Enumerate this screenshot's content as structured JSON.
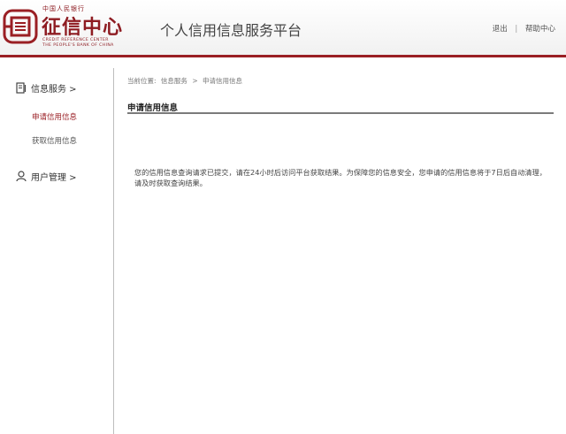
{
  "brand": {
    "top_text": "中国人民银行",
    "name": "征信中心",
    "en_line1": "CREDIT REFERENCE CENTER",
    "en_line2": "THE PEOPLE'S BANK OF CHINA",
    "color": "#9a1f24"
  },
  "header": {
    "title": "个人信用信息服务平台",
    "links": [
      {
        "label": "退出"
      },
      {
        "label": "帮助中心"
      }
    ],
    "separator": "|"
  },
  "sidebar": {
    "groups": [
      {
        "label": "信息服务 >",
        "icon": "document-icon",
        "items": [
          {
            "label": "申请信用信息",
            "active": true
          },
          {
            "label": "获取信用信息",
            "active": false
          }
        ]
      },
      {
        "label": "用户管理 >",
        "icon": "user-icon",
        "items": []
      }
    ]
  },
  "main": {
    "breadcrumb": {
      "prefix": "当前位置:",
      "parts": [
        "信息服务",
        ">",
        "申请信用信息"
      ]
    },
    "section_title": "申请信用信息",
    "message": "您的信用信息查询请求已提交，请在24小时后访问平台获取结果。为保障您的信息安全，您申请的信用信息将于7日后自动清理，请及时获取查询结果。"
  }
}
